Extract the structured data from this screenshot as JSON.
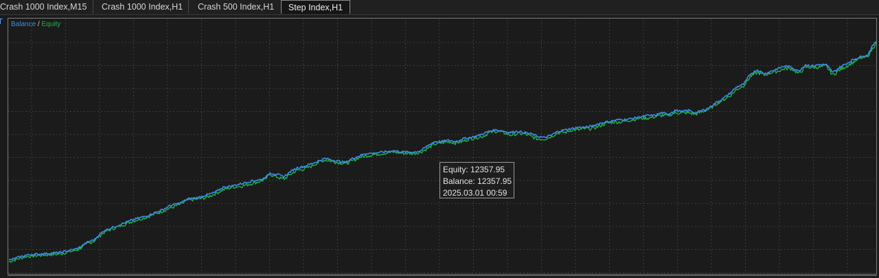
{
  "tabs": [
    {
      "label": "Crash 1000 Index,M15",
      "active": false
    },
    {
      "label": "Crash 1000 Index,H1",
      "active": false
    },
    {
      "label": "Crash 500 Index,H1",
      "active": false
    },
    {
      "label": "Step Index,H1",
      "active": true
    }
  ],
  "tooltip": {
    "equity": "Equity: 12357.95",
    "balance": "Balance: 12357.95",
    "time": "2025.03.01 00:59"
  },
  "colors": {
    "balance": "#3b8eea",
    "equity": "#22b14c",
    "grid": "#3e3e3e",
    "background": "#1b1b1b"
  },
  "chart_data": {
    "type": "line",
    "legend": [
      "Balance",
      "Equity"
    ],
    "legend_position": "top-left",
    "grid": true,
    "ylim": [
      0,
      100
    ],
    "series": [
      {
        "name": "Balance",
        "x": [
          0,
          25,
          50,
          75,
          100,
          115,
          125,
          130,
          140,
          150,
          165,
          180,
          200,
          215,
          225,
          235,
          250,
          260,
          275,
          287,
          300,
          312,
          325,
          340,
          355,
          368,
          375,
          380,
          390,
          400,
          410,
          420,
          430,
          440,
          450,
          460,
          470,
          480,
          490,
          500,
          510,
          520,
          530,
          545,
          560,
          575,
          590,
          600,
          610,
          620,
          630,
          640,
          650,
          660,
          670,
          680,
          690,
          700,
          710,
          720,
          730,
          740,
          750,
          760,
          770,
          780,
          790,
          800,
          810,
          820,
          830,
          840,
          850,
          860,
          870,
          880,
          890,
          900,
          910,
          920,
          930,
          940,
          950,
          960,
          970,
          980,
          990,
          1000,
          1010,
          1020,
          1030,
          1040,
          1050,
          1060,
          1070,
          1080,
          1090,
          1100,
          1110,
          1120,
          1130,
          1140,
          1150,
          1160,
          1170,
          1180,
          1190,
          1200,
          1210,
          1220,
          1230,
          1240,
          1250,
          1256,
          1263
        ],
        "values": [
          2,
          6,
          7,
          8,
          11,
          16,
          18,
          21,
          25,
          27,
          30,
          33,
          36,
          39,
          41,
          44,
          46,
          49,
          50,
          52,
          54,
          58,
          59,
          61,
          63,
          64,
          66,
          69,
          68,
          66,
          70,
          73,
          74,
          76,
          78,
          80,
          79,
          78,
          77,
          80,
          82,
          84,
          84,
          85,
          86,
          85,
          85,
          86,
          90,
          93,
          93,
          94,
          93,
          95,
          96,
          97,
          99,
          101,
          102,
          101,
          100,
          101,
          100,
          99,
          97,
          96,
          98,
          101,
          102,
          103,
          104,
          104,
          105,
          107,
          108,
          109,
          110,
          110,
          111,
          112,
          113,
          113,
          115,
          114,
          117,
          116,
          117,
          115,
          117,
          119,
          123,
          126,
          130,
          135,
          137,
          145,
          148,
          145,
          147,
          149,
          151,
          150,
          147,
          152,
          151,
          152,
          152,
          146,
          150,
          153,
          156,
          158,
          159,
          165,
          170
        ]
      },
      {
        "name": "Equity",
        "x": [
          0,
          25,
          50,
          75,
          100,
          115,
          125,
          130,
          140,
          150,
          165,
          180,
          200,
          215,
          225,
          235,
          250,
          260,
          275,
          287,
          300,
          312,
          325,
          340,
          355,
          368,
          375,
          380,
          390,
          400,
          410,
          420,
          430,
          440,
          450,
          460,
          470,
          480,
          490,
          500,
          510,
          520,
          530,
          545,
          560,
          575,
          590,
          600,
          610,
          620,
          630,
          640,
          650,
          660,
          670,
          680,
          690,
          700,
          710,
          720,
          730,
          740,
          750,
          760,
          770,
          780,
          790,
          800,
          810,
          820,
          830,
          840,
          850,
          860,
          870,
          880,
          890,
          900,
          910,
          920,
          930,
          940,
          950,
          960,
          970,
          980,
          990,
          1000,
          1010,
          1020,
          1030,
          1040,
          1050,
          1060,
          1070,
          1080,
          1090,
          1100,
          1110,
          1120,
          1130,
          1140,
          1150,
          1160,
          1170,
          1180,
          1190,
          1200,
          1210,
          1220,
          1230,
          1240,
          1250,
          1256,
          1263
        ],
        "values": [
          1,
          5,
          6,
          7,
          10,
          15,
          17,
          20,
          24,
          26,
          29,
          32,
          35,
          38,
          40,
          42,
          45,
          48,
          49,
          50,
          53,
          56,
          58,
          59,
          61,
          63,
          65,
          68,
          66,
          64,
          68,
          71,
          72,
          74,
          77,
          79,
          78,
          77,
          76,
          78,
          81,
          82,
          83,
          84,
          85,
          84,
          84,
          85,
          88,
          91,
          92,
          93,
          92,
          93,
          95,
          96,
          97,
          100,
          101,
          100,
          98,
          99,
          99,
          97,
          95,
          95,
          97,
          100,
          100,
          102,
          102,
          103,
          103,
          105,
          107,
          108,
          108,
          109,
          110,
          111,
          111,
          112,
          113,
          113,
          115,
          115,
          115,
          114,
          116,
          118,
          122,
          125,
          128,
          133,
          136,
          143,
          146,
          144,
          146,
          147,
          149,
          149,
          145,
          150,
          150,
          150,
          151,
          144,
          148,
          151,
          154,
          157,
          158,
          163,
          169
        ]
      }
    ]
  }
}
